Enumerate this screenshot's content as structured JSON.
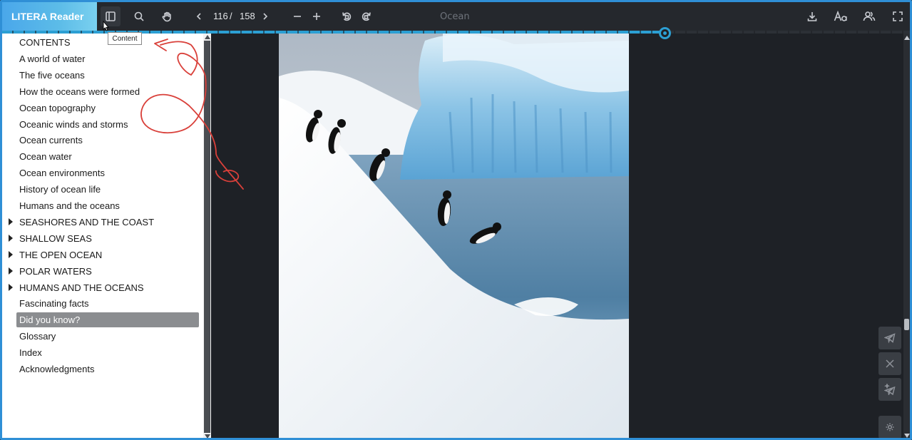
{
  "app": {
    "name": "LITERA Reader"
  },
  "toolbar": {
    "current_page": "116",
    "separator": "/",
    "total_pages": "158",
    "document_title": "Ocean",
    "tooltip": "Content",
    "icons": [
      "sidebar-toggle-icon",
      "search-icon",
      "hand-icon",
      "chevron-left-icon",
      "chevron-right-icon",
      "zoom-out-icon",
      "zoom-in-icon",
      "rotate-left-icon",
      "rotate-right-icon",
      "download-icon",
      "font-size-icon",
      "users-icon",
      "fullscreen-icon"
    ]
  },
  "progress": {
    "fraction": 0.73
  },
  "toc": {
    "items": [
      {
        "label": "CONTENTS",
        "expandable": false,
        "selected": false
      },
      {
        "label": "A world of water",
        "expandable": false,
        "selected": false
      },
      {
        "label": "The five oceans",
        "expandable": false,
        "selected": false
      },
      {
        "label": "How the oceans were formed",
        "expandable": false,
        "selected": false
      },
      {
        "label": "Ocean topography",
        "expandable": false,
        "selected": false
      },
      {
        "label": "Oceanic winds and storms",
        "expandable": false,
        "selected": false
      },
      {
        "label": "Ocean currents",
        "expandable": false,
        "selected": false
      },
      {
        "label": "Ocean water",
        "expandable": false,
        "selected": false
      },
      {
        "label": "Ocean environments",
        "expandable": false,
        "selected": false
      },
      {
        "label": "History of ocean life",
        "expandable": false,
        "selected": false
      },
      {
        "label": "Humans and the oceans",
        "expandable": false,
        "selected": false
      },
      {
        "label": "SEASHORES AND THE COAST",
        "expandable": true,
        "selected": false
      },
      {
        "label": "SHALLOW SEAS",
        "expandable": true,
        "selected": false
      },
      {
        "label": "THE OPEN OCEAN",
        "expandable": true,
        "selected": false
      },
      {
        "label": "POLAR WATERS",
        "expandable": true,
        "selected": false
      },
      {
        "label": "HUMANS AND THE OCEANS",
        "expandable": true,
        "selected": false
      },
      {
        "label": "Fascinating facts",
        "expandable": false,
        "selected": false
      },
      {
        "label": "Did you know?",
        "expandable": false,
        "selected": true
      },
      {
        "label": "Glossary",
        "expandable": false,
        "selected": false
      },
      {
        "label": "Index",
        "expandable": false,
        "selected": false
      },
      {
        "label": "Acknowledgments",
        "expandable": false,
        "selected": false
      }
    ]
  },
  "share": {
    "icons": [
      "telegram-icon",
      "x-icon",
      "telegram-star-icon",
      "settings-icon"
    ]
  },
  "colors": {
    "accent": "#2c9fd3",
    "annotation": "#d9403a",
    "logo": "#4aa7ea"
  }
}
